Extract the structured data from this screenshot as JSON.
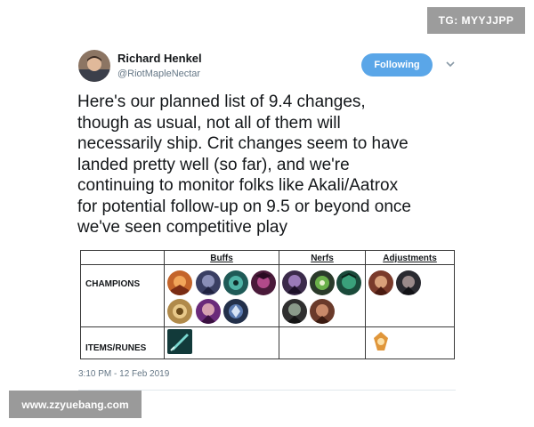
{
  "watermarks": {
    "top_right": "TG: MYYJJPP",
    "bottom_left": "www.zzyuebang.com"
  },
  "author": {
    "name": "Richard Henkel",
    "handle": "@RiotMapleNectar"
  },
  "follow_button_label": "Following",
  "tweet_lines": [
    "Here's our planned list of 9.4 changes,",
    "though as usual, not all of them will",
    "necessarily ship. Crit changes seem to have",
    "landed pretty well (so far), and we're",
    "continuing to monitor folks like Akali/Aatrox",
    "for potential follow-up on 9.5 or beyond once",
    "we've seen competitive play"
  ],
  "table": {
    "columns": [
      "Buffs",
      "Nerfs",
      "Adjustments"
    ],
    "rows": [
      "CHAMPIONS",
      "ITEMS/RUNES"
    ]
  },
  "timestamp": "3:10 PM - 12 Feb 2019",
  "colors": {
    "follow_button": "#5aa6e8",
    "meta_text": "#657786"
  }
}
